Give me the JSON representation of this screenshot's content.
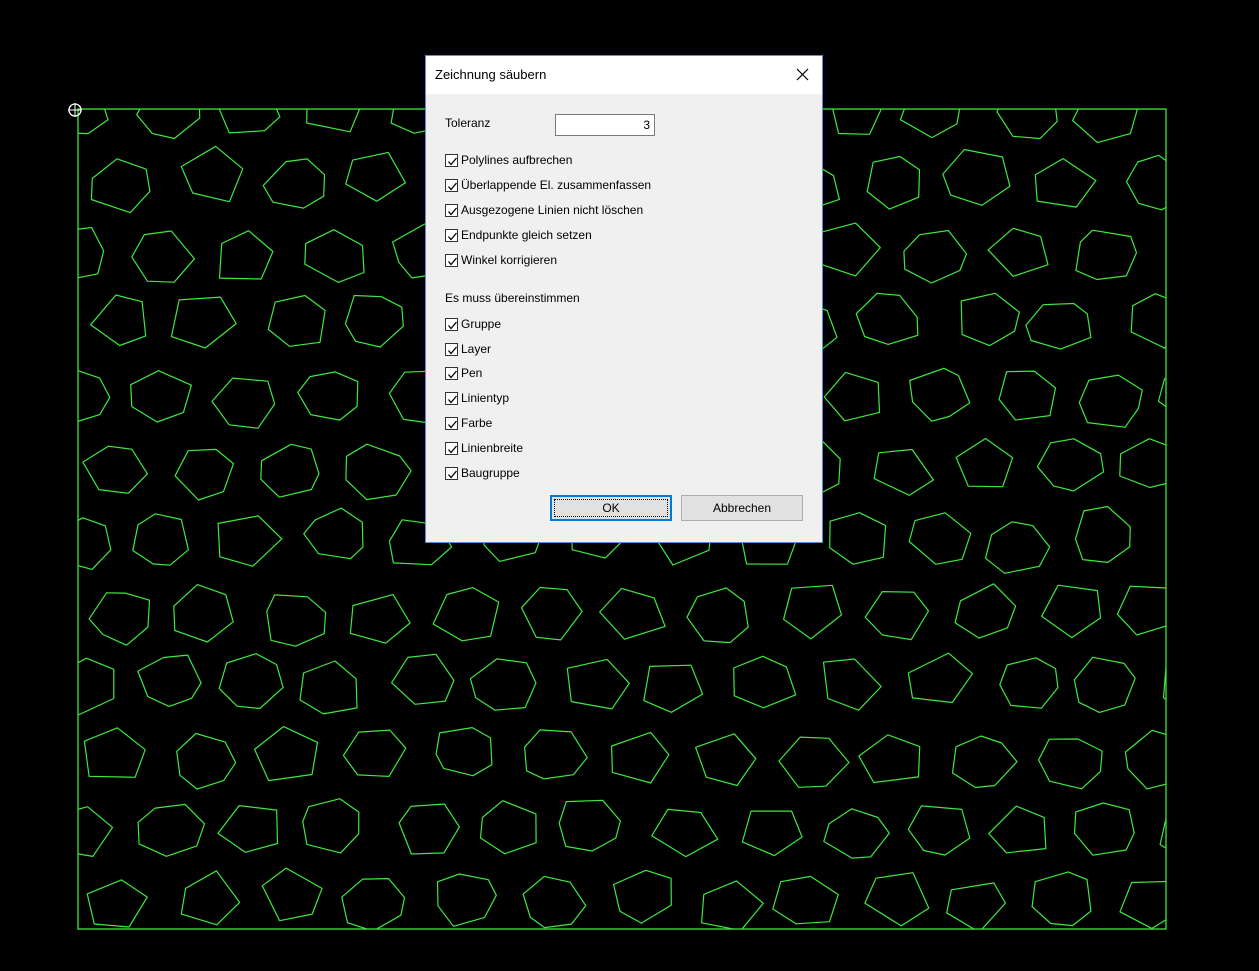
{
  "colors": {
    "canvas_background": "#000000",
    "drawing_lines": "#3ee83e",
    "dialog_background": "#f0f0f0",
    "dialog_border": "#5a8fd6",
    "ok_button_focus": "#0078d7"
  },
  "canvas": {
    "cursor_icon": "crosshair-circle-icon"
  },
  "dialog": {
    "title": "Zeichnung säubern",
    "close_icon": "close-icon",
    "tolerance": {
      "label": "Toleranz",
      "value": "3"
    },
    "options": [
      {
        "label": "Polylines aufbrechen",
        "checked": true
      },
      {
        "label": "Überlappende El. zusammenfassen",
        "checked": true
      },
      {
        "label": "Ausgezogene Linien nicht löschen",
        "checked": true
      },
      {
        "label": "Endpunkte gleich setzen",
        "checked": true
      },
      {
        "label": "Winkel korrigieren",
        "checked": true
      }
    ],
    "match_section": {
      "label": "Es muss übereinstimmen",
      "items": [
        {
          "label": "Gruppe",
          "checked": true
        },
        {
          "label": "Layer",
          "checked": true
        },
        {
          "label": "Pen",
          "checked": true
        },
        {
          "label": "Linientyp",
          "checked": true
        },
        {
          "label": "Farbe",
          "checked": true
        },
        {
          "label": "Linienbreite",
          "checked": true
        },
        {
          "label": "Baugruppe",
          "checked": true
        }
      ]
    },
    "ok_label": "OK",
    "cancel_label": "Abbrechen"
  }
}
